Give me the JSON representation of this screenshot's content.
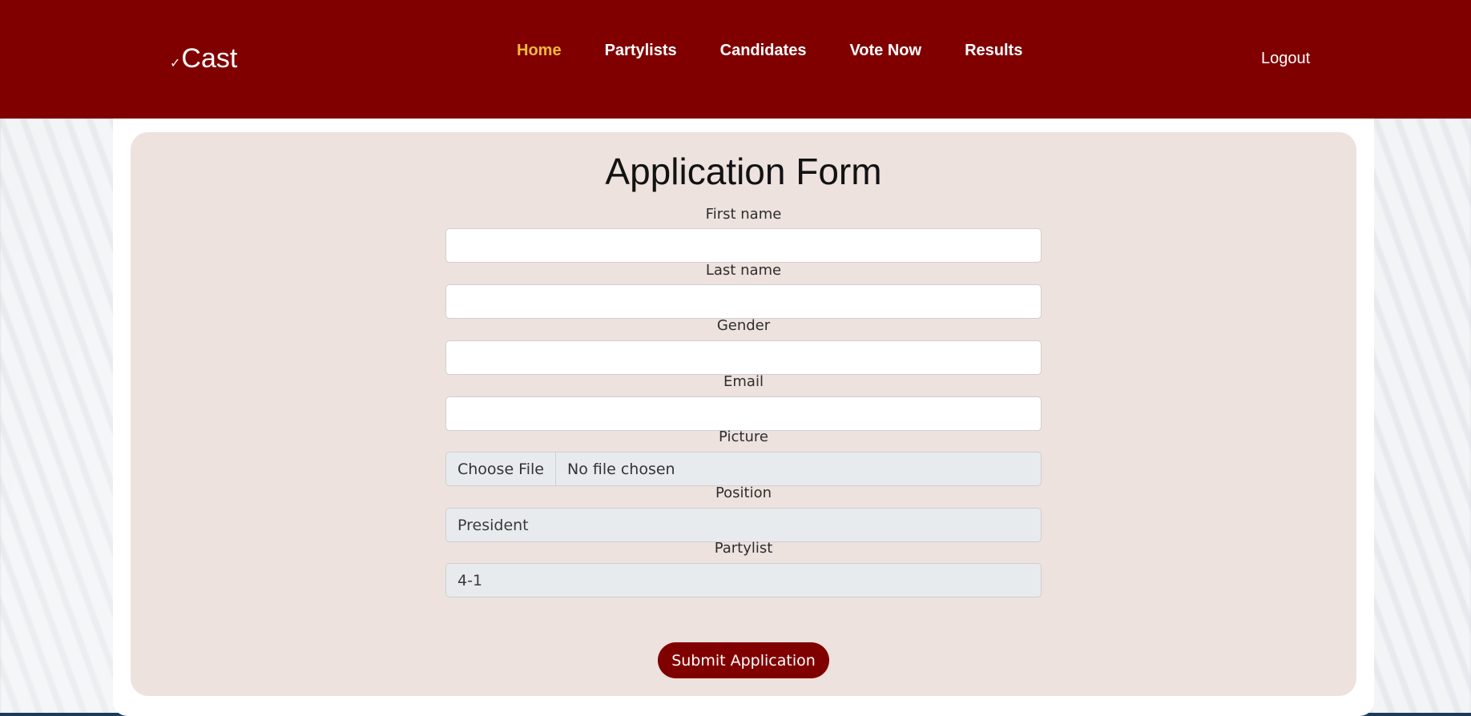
{
  "brand": {
    "logo_text": "Cast",
    "logo_icon": "ballot-check-icon"
  },
  "nav": {
    "links": [
      {
        "label": "Home",
        "active": true
      },
      {
        "label": "Partylists",
        "active": false
      },
      {
        "label": "Candidates",
        "active": false
      },
      {
        "label": "Vote Now",
        "active": false
      },
      {
        "label": "Results",
        "active": false
      }
    ],
    "logout_label": "Logout"
  },
  "colors": {
    "brand": "#800000",
    "active_link": "#f4b93c",
    "form_bg": "#ede2de"
  },
  "form": {
    "title": "Application Form",
    "fields": {
      "first_name": {
        "label": "First name",
        "value": ""
      },
      "last_name": {
        "label": "Last name",
        "value": ""
      },
      "gender": {
        "label": "Gender",
        "value": ""
      },
      "email": {
        "label": "Email",
        "value": ""
      },
      "picture": {
        "label": "Picture",
        "button": "Choose File",
        "status": "No file chosen"
      },
      "position": {
        "label": "Position",
        "value": "President"
      },
      "partylist": {
        "label": "Partylist",
        "value": "4-1"
      }
    },
    "submit_label": "Submit Application"
  }
}
